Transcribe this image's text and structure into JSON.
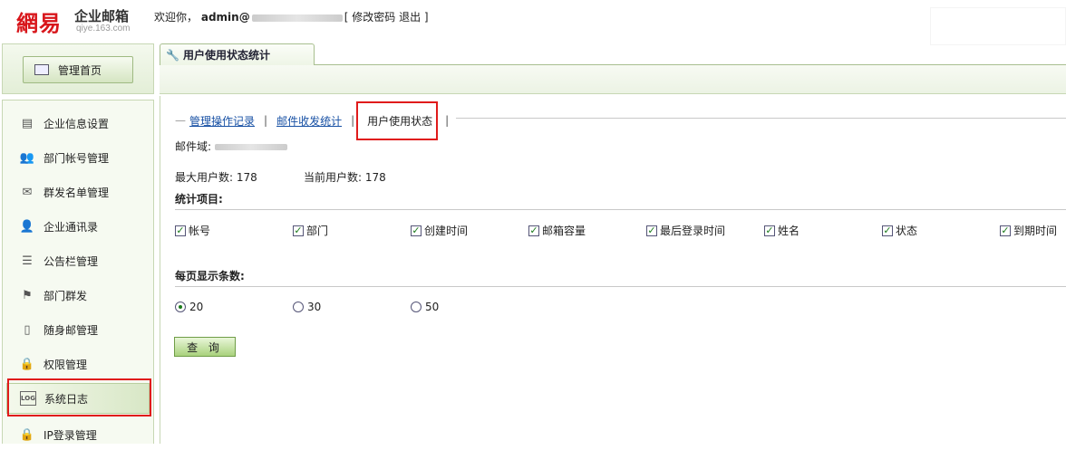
{
  "header": {
    "logo_mark": "網易",
    "logo_title": "企业邮箱",
    "logo_sub": "qiye.163.com",
    "welcome_prefix": "欢迎你，",
    "username": "admin@",
    "bracket_open": "[",
    "change_password": "修改密码",
    "logout": "退出",
    "bracket_close": "]"
  },
  "sidebar": {
    "home": "管理首页",
    "items": [
      {
        "label": "企业信息设置",
        "icon": "enterprise-settings-icon",
        "glyph": "▤"
      },
      {
        "label": "部门帐号管理",
        "icon": "users-icon",
        "glyph": "👥"
      },
      {
        "label": "群发名单管理",
        "icon": "mail-list-icon",
        "glyph": "✉"
      },
      {
        "label": "企业通讯录",
        "icon": "contacts-icon",
        "glyph": "👤"
      },
      {
        "label": "公告栏管理",
        "icon": "bulletin-icon",
        "glyph": "☰"
      },
      {
        "label": "部门群发",
        "icon": "department-mail-icon",
        "glyph": "⚑"
      },
      {
        "label": "随身邮管理",
        "icon": "mobile-mail-icon",
        "glyph": "▯"
      },
      {
        "label": "权限管理",
        "icon": "lock-icon",
        "glyph": "🔒"
      },
      {
        "label": "系统日志",
        "icon": "log-icon",
        "glyph": "LOG"
      },
      {
        "label": "IP登录管理",
        "icon": "ip-lock-icon",
        "glyph": "🔒"
      }
    ]
  },
  "main": {
    "tab_title": "用户使用状态统计",
    "subnav": {
      "dash": "—",
      "link1": "管理操作记录",
      "sep": "|",
      "link2": "邮件收发统计",
      "current": "用户使用状态"
    },
    "domain_label": "邮件域:",
    "max_users_label": "最大用户数: 178",
    "current_users_label": "当前用户数: 178",
    "stat_items_title": "统计项目:",
    "stat_items": [
      {
        "label": "帐号",
        "checked": true
      },
      {
        "label": "部门",
        "checked": true
      },
      {
        "label": "创建时间",
        "checked": true
      },
      {
        "label": "邮箱容量",
        "checked": true
      },
      {
        "label": "最后登录时间",
        "checked": true
      },
      {
        "label": "姓名",
        "checked": true
      },
      {
        "label": "状态",
        "checked": true
      },
      {
        "label": "到期时间",
        "checked": true
      }
    ],
    "per_page_title": "每页显示条数:",
    "per_page_options": [
      {
        "label": "20",
        "selected": true
      },
      {
        "label": "30",
        "selected": false
      },
      {
        "label": "50",
        "selected": false
      }
    ],
    "query_button": "查 询"
  }
}
